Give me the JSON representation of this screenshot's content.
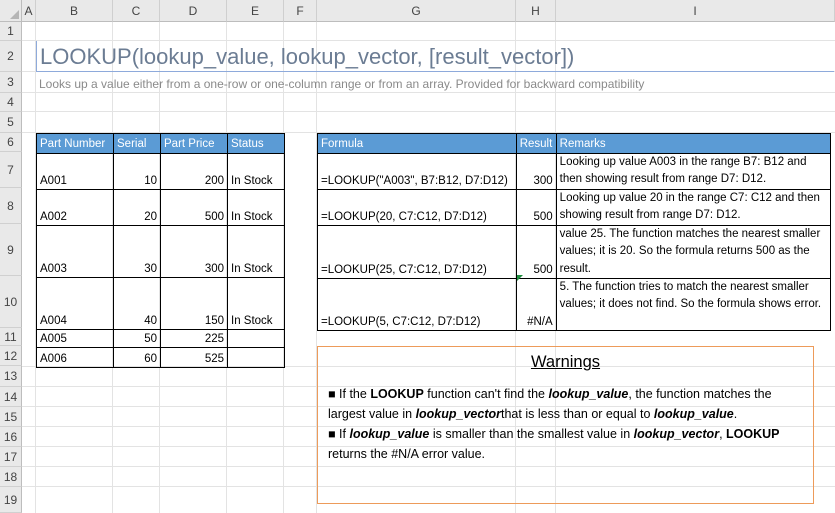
{
  "columns": [
    "A",
    "B",
    "C",
    "D",
    "E",
    "F",
    "G",
    "H",
    "I"
  ],
  "rows": [
    "1",
    "2",
    "3",
    "4",
    "5",
    "6",
    "7",
    "8",
    "9",
    "10",
    "11",
    "12",
    "13",
    "14",
    "15",
    "16",
    "17",
    "18",
    "19"
  ],
  "title": "LOOKUP(lookup_value, lookup_vector, [result_vector])",
  "subtitle": "Looks up a value either from a one-row or one-column range or from an array. Provided for backward compatibility",
  "data_table": {
    "headers": [
      "Part Number",
      "Serial",
      "Part Price",
      "Status"
    ],
    "rows": [
      {
        "part": "A001",
        "serial": "10",
        "price": "200",
        "status": "In Stock"
      },
      {
        "part": "A002",
        "serial": "20",
        "price": "500",
        "status": "In Stock"
      },
      {
        "part": "A003",
        "serial": "30",
        "price": "300",
        "status": "In Stock"
      },
      {
        "part": "A004",
        "serial": "40",
        "price": "150",
        "status": "In Stock"
      },
      {
        "part": "A005",
        "serial": "50",
        "price": "225",
        "status": ""
      },
      {
        "part": "A006",
        "serial": "60",
        "price": "525",
        "status": ""
      }
    ]
  },
  "formula_table": {
    "headers": [
      "Formula",
      "Result",
      "Remarks"
    ],
    "rows": [
      {
        "formula": "=LOOKUP(\"A003\", B7:B12, D7:D12)",
        "result": "300",
        "remarks": "Looking up value A003 in the range B7: B12 and then showing result from range D7: D12."
      },
      {
        "formula": "=LOOKUP(20, C7:C12, D7:D12)",
        "result": "500",
        "remarks": "Looking up value 20 in the range C7: C12 and then showing result from range D7: D12."
      },
      {
        "formula": "=LOOKUP(25, C7:C12, D7:D12)",
        "result": "500",
        "remarks": "value 25. The function matches the nearest smaller values; it is 20. So the formula returns 500 as the result."
      },
      {
        "formula": "=LOOKUP(5, C7:C12, D7:D12)",
        "result": "#N/A",
        "remarks": "5. The function tries to match the nearest smaller values; it does not find. So the formula shows error."
      }
    ]
  },
  "warnings": {
    "title": "Warnings",
    "bullet": "■",
    "p1_a": " If the ",
    "p1_b": "LOOKUP",
    "p1_c": " function can't find the ",
    "p1_d": "lookup_value",
    "p1_e": ", the function matches the largest value in ",
    "p1_f": "lookup_vector",
    "p1_g": "that is less than or equal to ",
    "p1_h": "lookup_value",
    "p1_i": ".",
    "p2_a": " If ",
    "p2_b": "lookup_value",
    "p2_c": " is smaller than the smallest value in ",
    "p2_d": "lookup_vector",
    "p2_e": ", ",
    "p2_f": "LOOKUP",
    "p2_g": " returns the #N/A error value."
  },
  "colors": {
    "header_blue": "#5b9bd5",
    "warning_border": "#ed9b5a",
    "title_underline": "#8eaadb"
  }
}
